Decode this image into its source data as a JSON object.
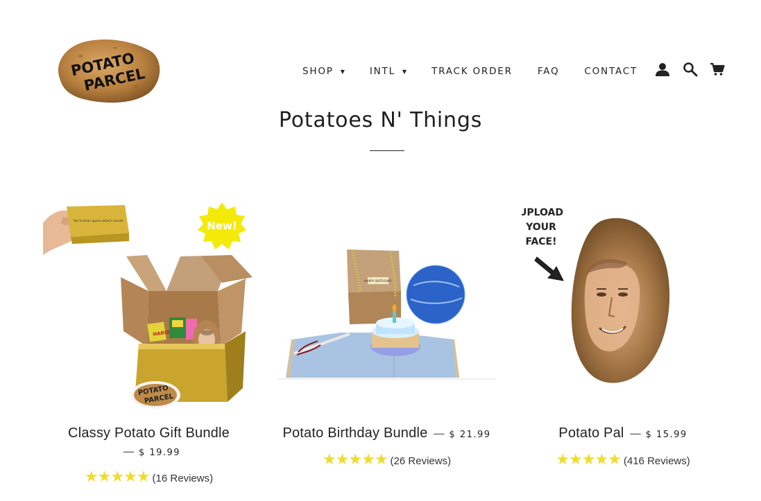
{
  "header": {
    "logo": {
      "line1": "POTATO",
      "line2": "PARCEL"
    },
    "nav": [
      {
        "label": "SHOP",
        "caret": "▼"
      },
      {
        "label": "INTL",
        "caret": "▼"
      },
      {
        "label": "TRACK ORDER"
      },
      {
        "label": "FAQ"
      },
      {
        "label": "CONTACT"
      }
    ],
    "icons": [
      "account-icon",
      "search-icon",
      "cart-icon"
    ]
  },
  "page": {
    "title": "Potatoes N' Things"
  },
  "products": [
    {
      "name": "Classy Potato Gift Bundle",
      "dash": "—",
      "price": "$ 19.99",
      "stars": "★★★★★",
      "reviews": "(16 Reviews)",
      "rating": 5,
      "badge": "New!",
      "box_text": "You'll never guess what's inside!",
      "sticker_line1": "POTATO",
      "sticker_line2": "PARCEL",
      "candy_label": "HARIBO"
    },
    {
      "name": "Potato Birthday Bundle",
      "dash": "—",
      "price": "$ 21.99",
      "stars": "★★★★★",
      "reviews": "(26 Reviews)",
      "rating": 5,
      "banner_text": "HAPPY BIRTHDAY!"
    },
    {
      "name": "Potato Pal",
      "dash": "—",
      "price": "$ 15.99",
      "stars": "★★★★★",
      "reviews": "(416 Reviews)",
      "rating": 5,
      "callout_line1": "UPLOAD",
      "callout_line2": "YOUR",
      "callout_line3": "FACE!"
    }
  ],
  "colors": {
    "star": "#f0dc29",
    "badge": "#f3ea0a",
    "potato": "#b98a4a",
    "accent_text": "#222222"
  }
}
